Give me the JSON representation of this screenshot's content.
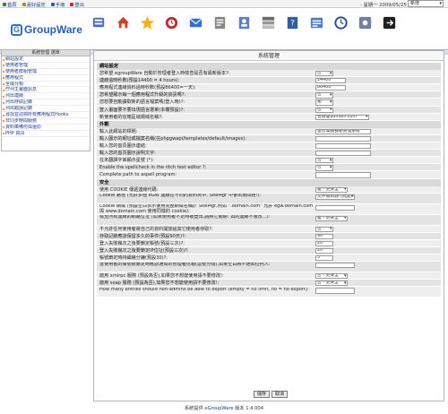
{
  "topbar": {
    "links": [
      {
        "label": "首頁",
        "icon": "home-icon",
        "color": "#3a7a3a"
      },
      {
        "label": "喜好設定",
        "icon": "preferences-icon",
        "color": "#c08020"
      },
      {
        "label": "手冊",
        "icon": "manual-icon",
        "color": "#2b5bb3"
      },
      {
        "label": "登出",
        "icon": "logout-icon",
        "color": "#b03030"
      }
    ],
    "date": "- 星期一 2009/05/25",
    "quick_add": "新增"
  },
  "logo": {
    "mark": "G",
    "text": "GroupWare"
  },
  "apps": [
    {
      "name": "app-icon-admin",
      "color": "#4a6fb5"
    },
    {
      "name": "app-icon-home",
      "color": "#d04030"
    },
    {
      "name": "app-icon-bookmarks",
      "color": "#f0b020"
    },
    {
      "name": "app-icon-calendar",
      "color": "#c03030"
    },
    {
      "name": "app-icon-email",
      "color": "#3a6fc8"
    },
    {
      "name": "app-icon-files",
      "color": "#888888"
    },
    {
      "name": "app-icon-addressbook",
      "color": "#5a80c0"
    },
    {
      "name": "app-icon-sitemgr",
      "color": "#6a6a6a"
    },
    {
      "name": "app-icon-manual",
      "color": "#3060a0"
    },
    {
      "name": "app-icon-timesheet",
      "color": "#5080c0"
    },
    {
      "name": "app-icon-clock",
      "color": "#2a4a90"
    },
    {
      "name": "app-icon-preferences",
      "color": "#7080a0"
    },
    {
      "name": "app-icon-logout",
      "color": "#202020"
    }
  ],
  "sidebar": {
    "title": "系統管理 選單",
    "items": [
      "網站設定",
      "使用者管理",
      "使用者群組管理",
      "應用程式",
      "全域分類",
      "佇列主畫面訊息",
      "列出連線",
      "列出存取記錄",
      "列出錯誤記錄",
      "尋找並註冊所有應用程式Hooks",
      "非同步時間服務",
      "資料庫備份與還原",
      "PHP 資訊"
    ]
  },
  "main": {
    "title": "系統管理",
    "sections": [
      {
        "title": "網站設定",
        "rows": [
          {
            "label": "您希望 egroupWare 自動於管理者登入時檢查是否有最新版本?:",
            "type": "select",
            "value": "否",
            "w": 20
          },
          {
            "label": "連線逾時秒數(預設14400 = 4 hours):",
            "type": "input",
            "value": "14400",
            "w": 34
          },
          {
            "label": "應用程式連線資料過時秒數(預設86400=一天):",
            "type": "input",
            "value": "86400",
            "w": 34
          },
          {
            "label": "您希望顯示每一個應用程式升級的資訊嗎?:",
            "type": "select",
            "value": "否",
            "w": 20
          },
          {
            "label": "您想要自動讀取新的語言檔案嗎(登入時)?:",
            "type": "select",
            "value": "是",
            "w": 20
          },
          {
            "label": "登入畫面要不要出現語言選單(本欄預設)?:",
            "type": "select",
            "value": "否",
            "w": 20
          },
          {
            "label": "新使用者的信箱區域網域名稱?:",
            "type": "select",
            "value": "名稱@domain.com",
            "w": 60
          }
        ]
      },
      {
        "title": "外觀",
        "rows": [
          {
            "label": "輸入此網站的標題:",
            "type": "input",
            "value": "當智電腦群組管理系統",
            "w": 62
          },
          {
            "label": "輸入圖示的網址或檔案名稱(在phpgwapi/templates/default/images):",
            "type": "input",
            "value": "",
            "w": 62
          },
          {
            "label": "輸入您的首頁圖示連結:",
            "type": "input",
            "value": "",
            "w": 62
          },
          {
            "label": "輸入您的首頁圖示說明文字:",
            "type": "input",
            "value": "",
            "w": 62
          },
          {
            "label": "在未翻譯字串顯示星號 (*):",
            "type": "select",
            "value": "否",
            "w": 20
          },
          {
            "label": "Enable the spellcheck in the ritch text editor ?:",
            "type": "select",
            "value": "否",
            "w": 20
          },
          {
            "label": "Complete path to aspell program:",
            "type": "input",
            "value": "",
            "w": 62
          }
        ]
      },
      {
        "title": "安全",
        "rows": [
          {
            "label": "使用 COOKIE 傳遞連線代碼:",
            "type": "select",
            "value": "是 - 更安全",
            "w": 36
          },
          {
            "label": "Cookie 路徑 (允許多個 eGW 連線在不同的資料夾中, SiteMgr 中會出現問題!):",
            "type": "select",
            "value": "文件根目錄 (預設)",
            "w": 44,
            "tall": true
          },
          {
            "label": "Cookie 網域 (預設空白表示使用完整網域名稱於 SiteMgr,例如 \".domain.com\" 允許 egw.domain.com 與 www.domain.com 使用同樣的 cookie):",
            "type": "input",
            "value": "",
            "w": 44,
            "tall": true
          },
          {
            "label": "檢查所有連線的網路位址 (如果使用者不定時被登出,請將它關閉: 如的連線不會改...):",
            "type": "select",
            "value": "是 - 更安全",
            "w": 36,
            "tall": true
          },
          {
            "label": "不允許任何使用者將自己的資料開放給其它使用者存取?:",
            "type": "select",
            "value": "否",
            "w": 20
          },
          {
            "label": "存取記錄應該保留多久的事件(預設90天)?:",
            "type": "input",
            "value": "90",
            "w": 20
          },
          {
            "label": "登入失敗幾次之後要鎖定帳號(預設三次)?:",
            "type": "input",
            "value": "20",
            "w": 20
          },
          {
            "label": "登入失敗幾次之後要鎖定IP位址(預設三次)?:",
            "type": "input",
            "value": "20",
            "w": 20
          },
          {
            "label": "帳號鎖定時持續幾分鐘(預設30)?:",
            "type": "input",
            "value": "5",
            "w": 20
          },
          {
            "label": "當使用者的帳號被鎖定時應該通知的管理者信箱(逗號分隔),如果空白將不通知任何人:",
            "type": "input",
            "value": "",
            "w": 44,
            "tall": true
          },
          {
            "label": "啟用 xmlrpc 服務 (預設為否),如果您不想變使用請不要修改!:",
            "type": "select",
            "value": "否 - 更安全",
            "w": 36
          },
          {
            "label": "啟用 soap 服務 (預設為否),如果您不想變使用請不要修改!:",
            "type": "select",
            "value": "否 - 更安全",
            "w": 36
          },
          {
            "label": "How many entries should non-admins be able to export (empty = no limit, no = no export):",
            "type": "input",
            "value": "",
            "w": 44,
            "tall": true
          }
        ]
      }
    ],
    "save_label": "儲存",
    "cancel_label": "取消"
  },
  "footer": {
    "prefix": "系統提供 ",
    "link": "eGroupWare",
    "suffix": " 版本 1.4.004"
  }
}
